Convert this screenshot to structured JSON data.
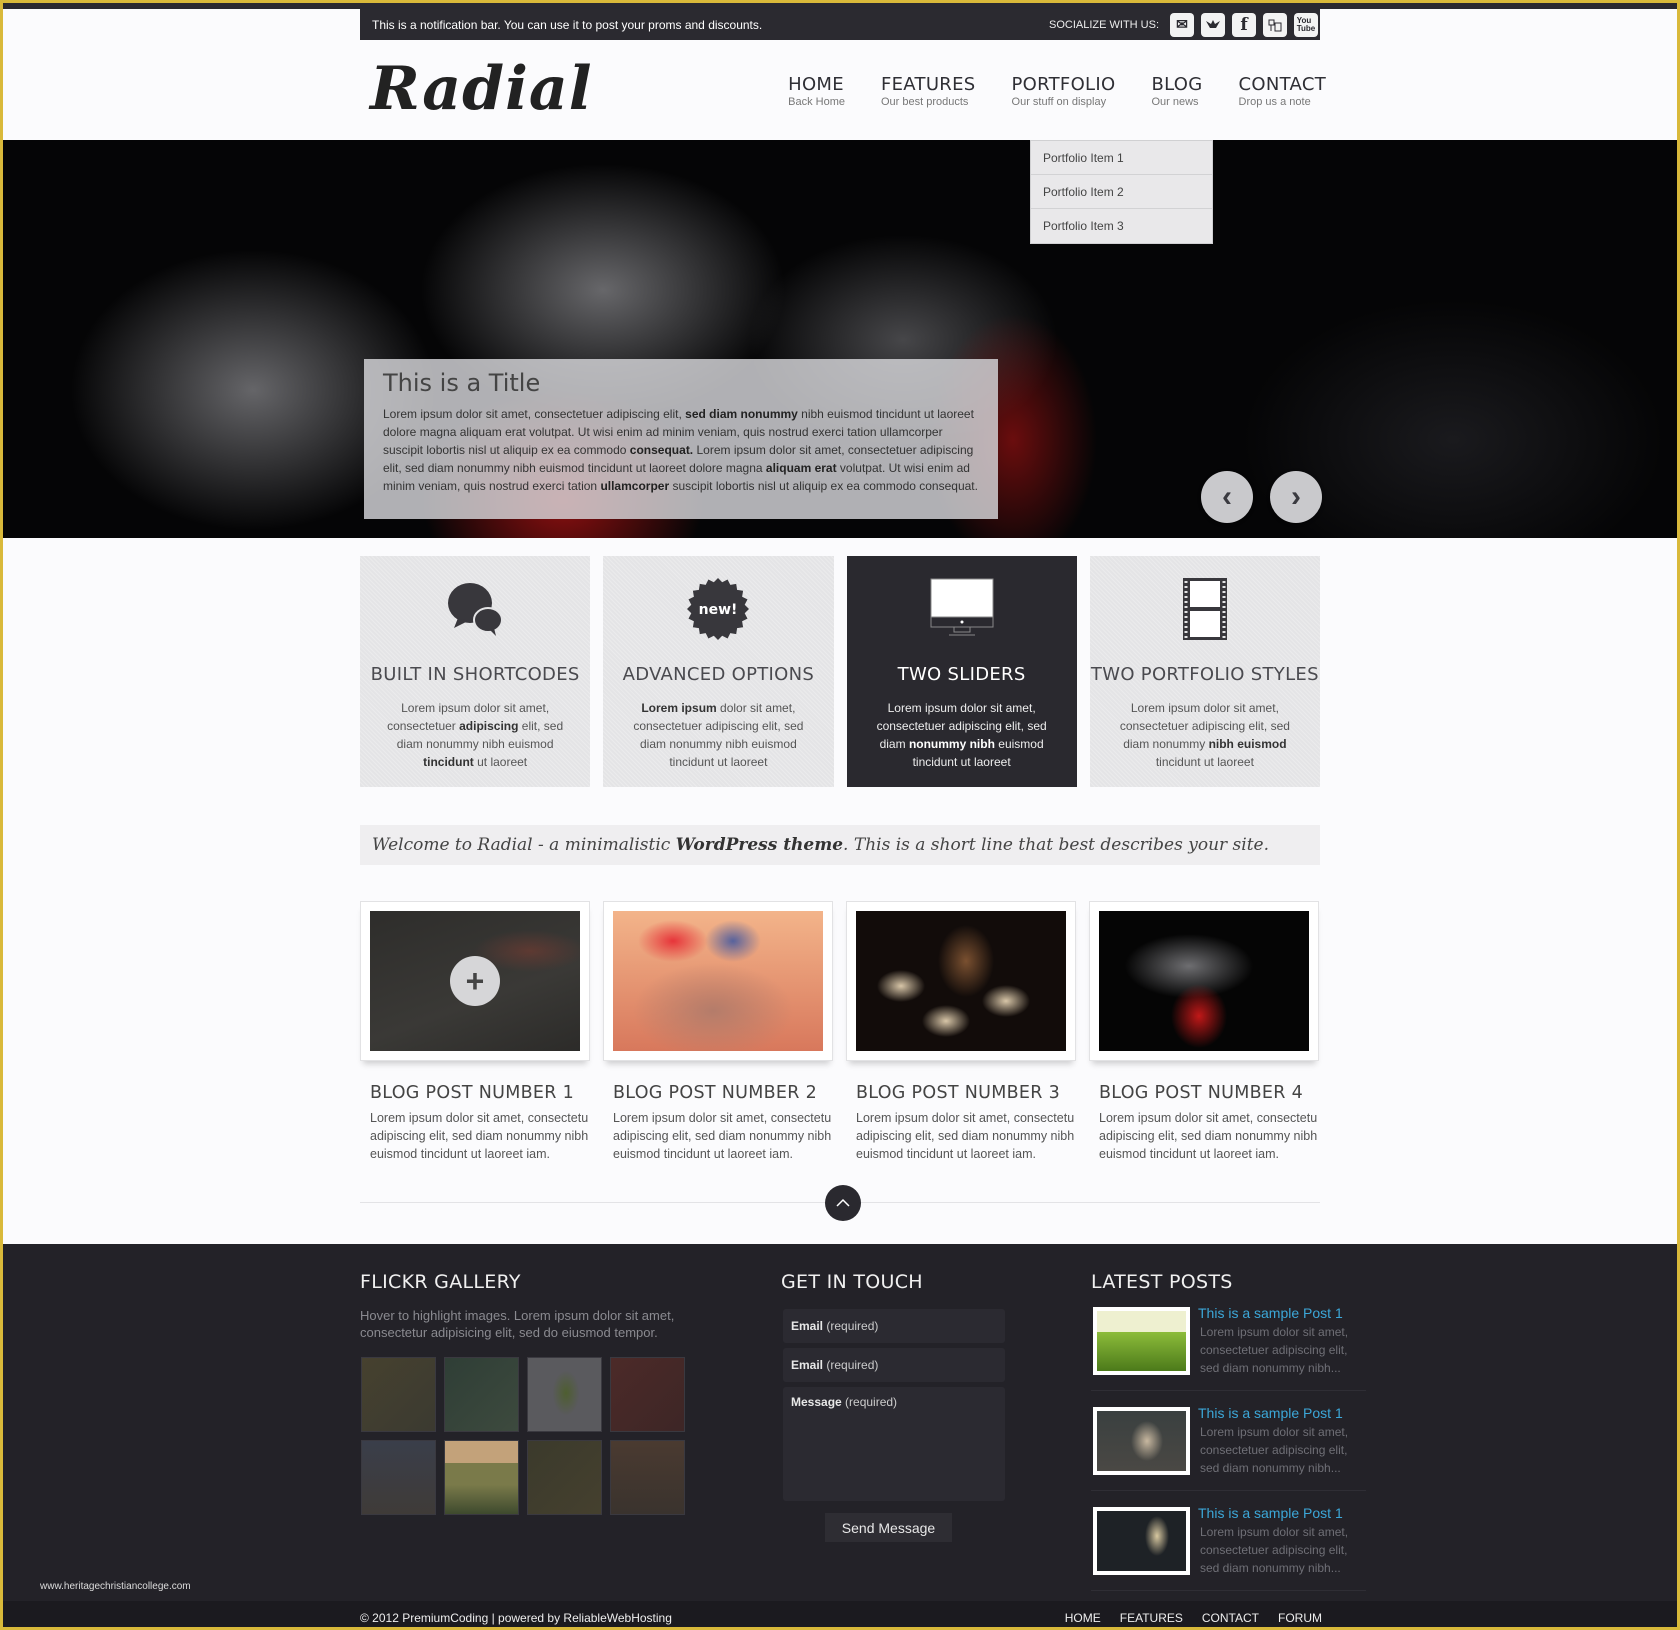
{
  "notification": {
    "text": "This is a notification bar. You can use it to post your proms and discounts.",
    "social_label": "SOCIALIZE WITH US:",
    "social_icons": [
      "mail-icon",
      "twitter-icon",
      "facebook-icon",
      "flickr-icon",
      "youtube-icon"
    ]
  },
  "header": {
    "logo": "Radial",
    "nav": [
      {
        "title": "HOME",
        "sub": "Back Home"
      },
      {
        "title": "FEATURES",
        "sub": "Our best products"
      },
      {
        "title": "PORTFOLIO",
        "sub": "Our stuff on display"
      },
      {
        "title": "BLOG",
        "sub": "Our news"
      },
      {
        "title": "CONTACT",
        "sub": "Drop us a note"
      }
    ],
    "portfolio_dropdown": [
      "Portfolio Item 1",
      "Portfolio Item 2",
      "Portfolio Item 3"
    ]
  },
  "hero": {
    "title": "This is a Title",
    "text_parts": [
      "Lorem ipsum dolor sit amet, consectetuer adipiscing elit, ",
      "sed diam nonummy",
      " nibh euismod tincidunt ut laoreet dolore magna aliquam erat volutpat. Ut wisi enim ad minim veniam, quis nostrud exerci tation ullamcorper suscipit lobortis nisl ut aliquip ex ea commodo ",
      "consequat.",
      " Lorem ipsum dolor sit amet, consectetuer adipiscing elit, sed diam nonummy nibh euismod tincidunt ut laoreet dolore magna ",
      "aliquam erat",
      " volutpat. Ut wisi enim ad minim veniam, quis nostrud exerci tation ",
      "ullamcorper",
      " suscipit lobortis nisl ut aliquip ex ea commodo consequat."
    ],
    "prev_label": "‹",
    "next_label": "›"
  },
  "features": [
    {
      "title": "BUILT IN SHORTCODES",
      "icon": "speech-bubbles-icon",
      "parts": [
        "Lorem ipsum dolor sit amet, consectetuer ",
        "adipiscing",
        " elit, sed diam nonummy nibh euismod ",
        "tincidunt",
        " ut laoreet"
      ]
    },
    {
      "title": "ADVANCED OPTIONS",
      "icon": "new-badge-icon",
      "badge_text": "new!",
      "parts": [
        "",
        "Lorem ipsum",
        " dolor sit amet, consectetuer adipiscing elit, sed diam nonummy nibh euismod tincidunt ut laoreet",
        "",
        ""
      ]
    },
    {
      "title": "TWO SLIDERS",
      "icon": "monitor-icon",
      "parts": [
        "Lorem ipsum dolor sit amet, consectetuer adipiscing elit, sed diam ",
        "nonummy nibh",
        " euismod tincidunt ut laoreet",
        "",
        ""
      ]
    },
    {
      "title": "TWO PORTFOLIO STYLES",
      "icon": "film-strip-icon",
      "parts": [
        "Lorem ipsum dolor sit amet, consectetuer adipiscing elit, sed diam nonummy ",
        "nibh euismod",
        " tincidunt ut laoreet",
        "",
        ""
      ]
    }
  ],
  "welcome": {
    "before": "Welcome to Radial - a minimalistic ",
    "bold": "WordPress theme",
    "after": ". This is a short line that best describes your site."
  },
  "blog_posts": [
    {
      "title": "BLOG POST NUMBER 1",
      "text": "Lorem ipsum dolor sit amet, consectetu adipiscing elit, sed diam nonummy nibh euismod tincidunt ut laoreet iam."
    },
    {
      "title": "BLOG POST NUMBER 2",
      "text": "Lorem ipsum dolor sit amet, consectetu adipiscing elit, sed diam nonummy nibh euismod tincidunt ut laoreet iam."
    },
    {
      "title": "BLOG POST NUMBER 3",
      "text": "Lorem ipsum dolor sit amet, consectetu adipiscing elit, sed diam nonummy nibh euismod tincidunt ut laoreet iam."
    },
    {
      "title": "BLOG POST NUMBER 4",
      "text": "Lorem ipsum dolor sit amet, consectetu adipiscing elit, sed diam nonummy nibh euismod tincidunt ut laoreet iam."
    }
  ],
  "footer": {
    "flickr": {
      "title": "FLICKR GALLERY",
      "desc": "Hover to highlight images. Lorem ipsum dolor sit amet, consectetur adipisicing elit, sed do eiusmod tempor."
    },
    "contact": {
      "title": "GET IN TOUCH",
      "fields": [
        {
          "label": "Email",
          "hint": " (required)"
        },
        {
          "label": "Email",
          "hint": " (required)"
        },
        {
          "label": "Message",
          "hint": " (required)"
        }
      ],
      "send_label": "Send Message"
    },
    "latest": {
      "title": "LATEST POSTS",
      "posts": [
        {
          "title": "This is a sample Post 1",
          "text": "Lorem ipsum dolor sit amet, consectetuer adipiscing elit, sed diam nonummy nibh..."
        },
        {
          "title": "This is a sample Post 1",
          "text": "Lorem ipsum dolor sit amet, consectetuer adipiscing elit, sed diam nonummy nibh..."
        },
        {
          "title": "This is a sample Post 1",
          "text": "Lorem ipsum dolor sit amet, consectetuer adipiscing elit, sed diam nonummy nibh..."
        }
      ]
    },
    "watermark": "www.heritagechristiancollege.com",
    "copyright": "© 2012 PremiumCoding | powered by ReliableWebHosting",
    "nav": [
      "HOME",
      "FEATURES",
      "CONTACT",
      "FORUM"
    ]
  },
  "colors": {
    "accent_link": "#3ca7d8",
    "dark": "#2a292f",
    "frame_border": "#d9b93a"
  }
}
